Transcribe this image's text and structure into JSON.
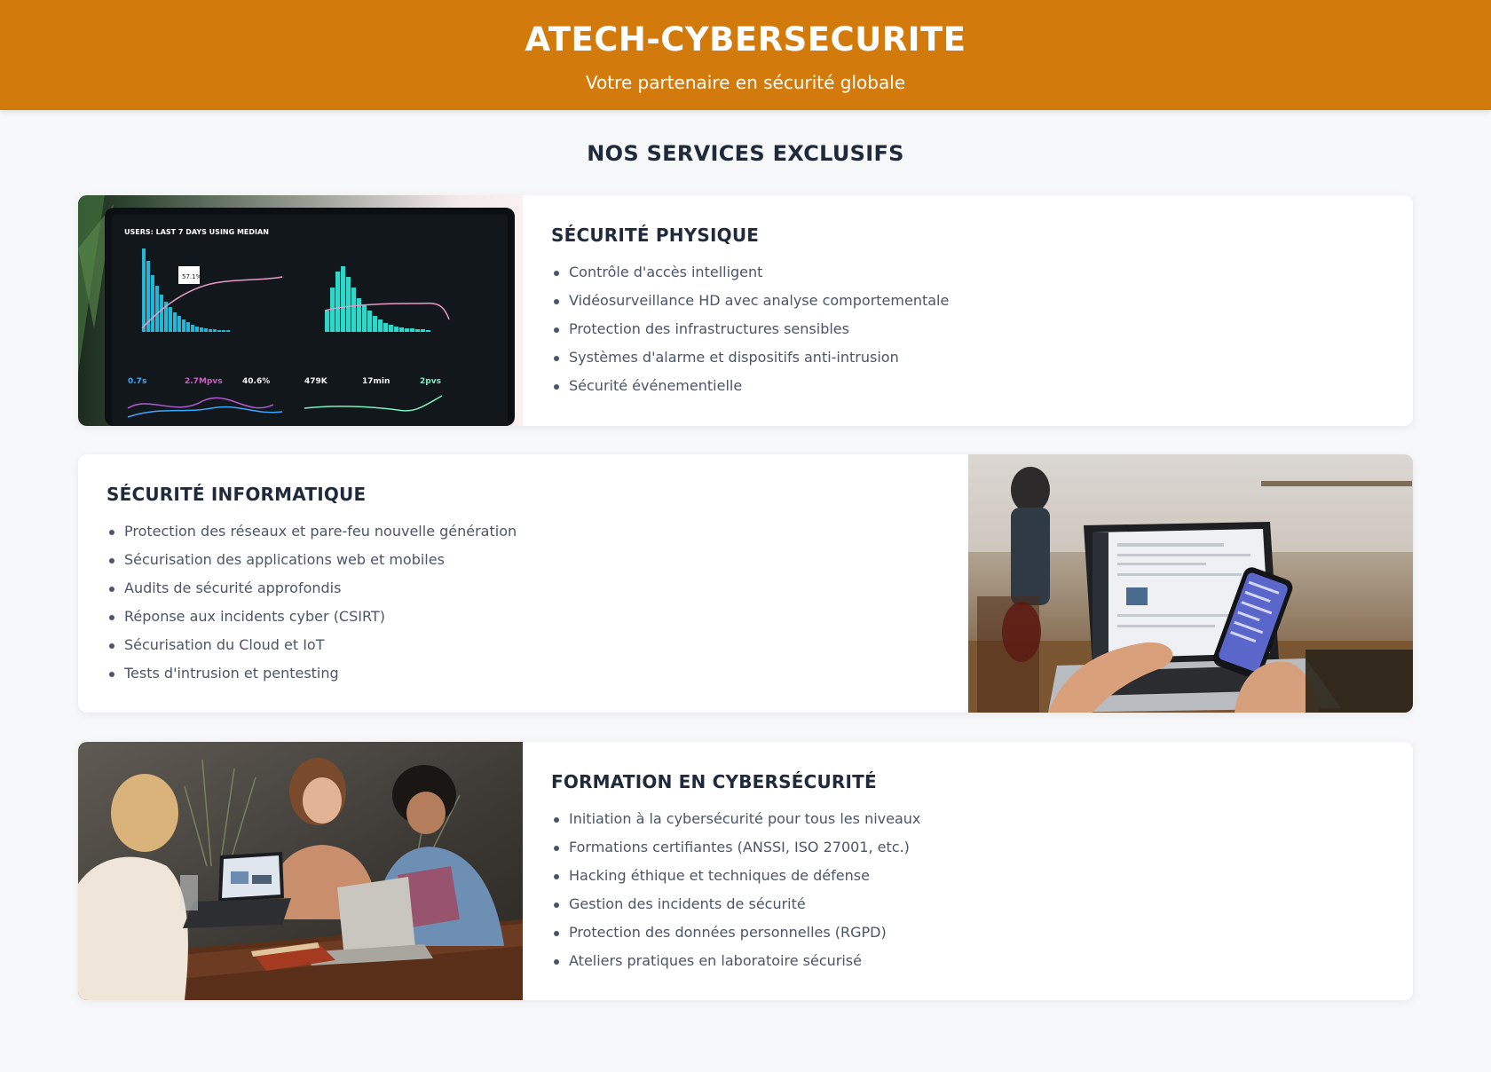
{
  "header": {
    "title": "ATECH-CYBERSECURITE",
    "subtitle": "Votre partenaire en sécurité globale"
  },
  "main": {
    "section_title": "NOS SERVICES EXCLUSIFS",
    "services": [
      {
        "title": "SÉCURITÉ PHYSIQUE",
        "image": "laptop-analytics-dashboard-photo",
        "items": [
          "Contrôle d'accès intelligent",
          "Vidéosurveillance HD avec analyse comportementale",
          "Protection des infrastructures sensibles",
          "Systèmes d'alarme et dispositifs anti-intrusion",
          "Sécurité événementielle"
        ]
      },
      {
        "title": "SÉCURITÉ INFORMATIQUE",
        "image": "laptop-and-phone-cafe-photo",
        "items": [
          "Protection des réseaux et pare-feu nouvelle génération",
          "Sécurisation des applications web et mobiles",
          "Audits de sécurité approfondis",
          "Réponse aux incidents cyber (CSIRT)",
          "Sécurisation du Cloud et IoT",
          "Tests d'intrusion et pentesting"
        ]
      },
      {
        "title": "FORMATION EN CYBERSÉCURITÉ",
        "image": "group-training-laptops-photo",
        "items": [
          "Initiation à la cybersécurité pour tous les niveaux",
          "Formations certifiantes (ANSSI, ISO 27001, etc.)",
          "Hacking éthique et techniques de défense",
          "Gestion des incidents de sécurité",
          "Protection des données personnelles (RGPD)",
          "Ateliers pratiques en laboratoire sécurisé"
        ]
      }
    ]
  },
  "dashboard_image": {
    "heading": "USERS: LAST 7 DAYS USING MEDIAN",
    "callout": "57.1%",
    "metrics": [
      "0.7s",
      "2.7Mpvs",
      "40.6%",
      "479K",
      "17min",
      "2pvs"
    ]
  },
  "colors": {
    "header_bg": "#d27a0b",
    "page_bg": "#f7f8fa",
    "heading_text": "#1f2a3c",
    "body_text": "#4a5568"
  }
}
